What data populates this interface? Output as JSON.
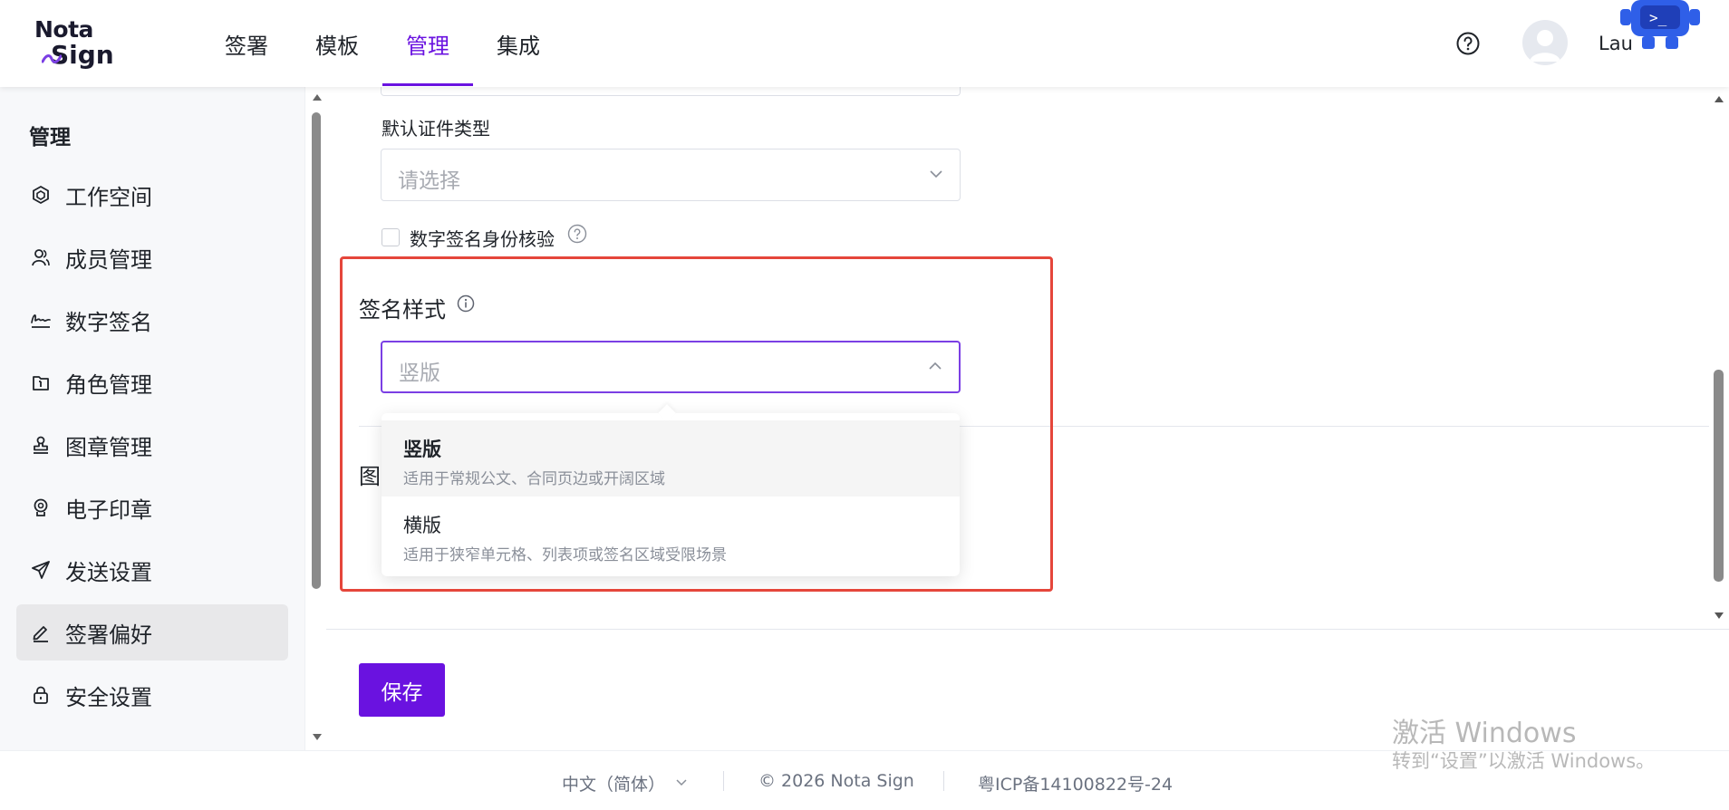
{
  "brand": {
    "line1": "Nota",
    "line2": "Sign"
  },
  "nav": {
    "items": [
      "签署",
      "模板",
      "管理",
      "集成"
    ],
    "active_index": 2
  },
  "user": {
    "name": "Lau"
  },
  "sidebar": {
    "title": "管理",
    "items": [
      {
        "label": "工作空间",
        "icon": "workspace-icon"
      },
      {
        "label": "成员管理",
        "icon": "members-icon"
      },
      {
        "label": "数字签名",
        "icon": "signature-icon"
      },
      {
        "label": "角色管理",
        "icon": "role-icon"
      },
      {
        "label": "图章管理",
        "icon": "stamp-icon"
      },
      {
        "label": "电子印章",
        "icon": "seal-icon"
      },
      {
        "label": "发送设置",
        "icon": "send-icon"
      },
      {
        "label": "签署偏好",
        "icon": "edit-icon"
      },
      {
        "label": "安全设置",
        "icon": "lock-icon"
      }
    ],
    "active_index": 7
  },
  "form": {
    "cert_type_label": "默认证件类型",
    "cert_type_placeholder": "请选择",
    "digital_sig_check_label": "数字签名身份核验",
    "sig_style_title": "签名样式",
    "sig_style_value": "竖版",
    "hidden_section_title": "图"
  },
  "dropdown": {
    "options": [
      {
        "title": "竖版",
        "desc": "适用于常规公文、合同页边或开阔区域",
        "selected": true
      },
      {
        "title": "横版",
        "desc": "适用于狭窄单元格、列表项或签名区域受限场景",
        "selected": false
      }
    ]
  },
  "save_label": "保存",
  "footer": {
    "language": "中文（简体）",
    "copyright": "© 2026 Nota Sign",
    "icp": "粤ICP备14100822号-24"
  },
  "watermark": {
    "line1": "激活 Windows",
    "line2": "转到“设置”以激活 Windows。"
  },
  "colors": {
    "accent": "#6a12e0",
    "highlight": "#e5463b"
  }
}
